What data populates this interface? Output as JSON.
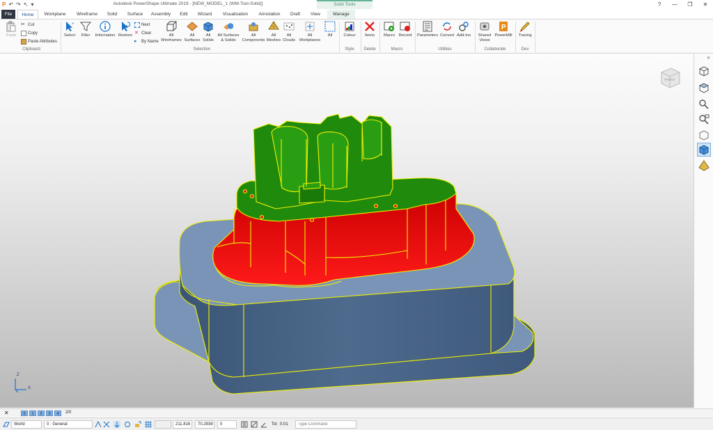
{
  "app": {
    "title": "Autodesk PowerShape Ultimate 2019 - [NEW_MODEL_1 (WM-Tool-Solid)]",
    "context_tab_title": "Solid Tools"
  },
  "quick_access": [
    "P",
    "↶",
    "↷",
    "↖",
    "▾"
  ],
  "window_controls": [
    "?",
    "—",
    "❐",
    "✕"
  ],
  "mdi_controls": [
    "▾",
    "—",
    "❐",
    "✕"
  ],
  "tabs": [
    {
      "label": "File"
    },
    {
      "label": "Home"
    },
    {
      "label": "Workplane"
    },
    {
      "label": "Wireframe"
    },
    {
      "label": "Solid"
    },
    {
      "label": "Surface"
    },
    {
      "label": "Assembly"
    },
    {
      "label": "Edit"
    },
    {
      "label": "Wizard"
    },
    {
      "label": "Visualisation"
    },
    {
      "label": "Annotation"
    },
    {
      "label": "Draft"
    },
    {
      "label": "View"
    },
    {
      "label": "Manage"
    }
  ],
  "ribbon": {
    "clipboard": {
      "paste": "Paste",
      "cut": "Cut",
      "copy": "Copy",
      "paste_attributes": "Paste Attributes",
      "group": "Clipboard"
    },
    "selection": {
      "select": "Select",
      "filter": "Filter",
      "information": "Information",
      "restore": "Restore",
      "next": "Next",
      "clear": "Clear",
      "by_name": "By Name",
      "all_wireframes": "All\nWireframes",
      "all_surfaces": "All\nSurfaces",
      "all_solids": "All\nSolids",
      "all_surfaces_solids": "All Surfaces\n& Solids",
      "all_components": "All\nComponents",
      "all_meshes": "All\nMeshes",
      "all_clouds": "All\nClouds",
      "all_workplanes": "All\nWorkplanes",
      "all": "All",
      "group": "Selection"
    },
    "style": {
      "colour": "Colour",
      "group": "Style"
    },
    "delete": {
      "items": "Items",
      "group": "Delete"
    },
    "macro": {
      "macro": "Macro",
      "record": "Record",
      "group": "Macro"
    },
    "utilities": {
      "parameters": "Parameters",
      "convert": "Convert",
      "addins": "Add-Ins",
      "group": "Utilities"
    },
    "collaborate": {
      "shared_views": "Shared\nViews",
      "powermill": "PowerMill",
      "group": "Collaborate"
    },
    "dev": {
      "tracing": "Tracing",
      "group": "Dev"
    }
  },
  "viewcube": {
    "face": "FRONT"
  },
  "axis": {
    "z": "Z",
    "x": "X"
  },
  "levels": {
    "close": "✕",
    "items": [
      "0",
      "1",
      "2",
      "3",
      "4"
    ],
    "count": "2/0"
  },
  "status": {
    "workplane": "World",
    "level": "0 : General",
    "x": "211.816",
    "y": "70.2938",
    "z": "0",
    "tol_label": "Tol",
    "tol_value": "0.01",
    "command_placeholder": "Type Command"
  },
  "colors": {
    "green_face": "#1f8a0c",
    "red_face": "#d60000",
    "blue_face": "#4e6a8c",
    "edge_yellow": "#f0f000",
    "blue_top": "#7a94b8"
  }
}
